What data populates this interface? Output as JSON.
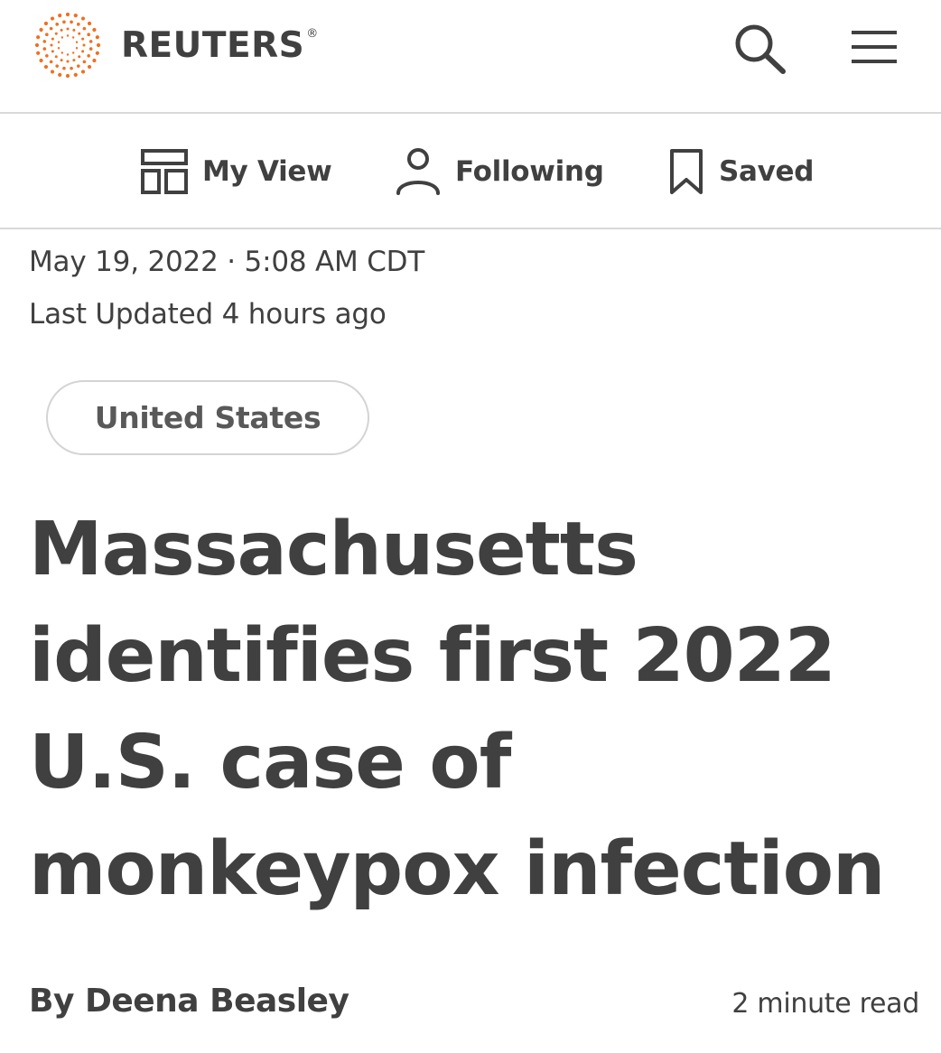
{
  "header": {
    "brand_name": "REUTERS",
    "brand_registered": "®",
    "brand_color": "#f26e1e",
    "search_icon": "search-icon",
    "menu_icon": "hamburger-menu-icon"
  },
  "subnav": {
    "items": [
      {
        "label": "My View",
        "icon": "layout-icon"
      },
      {
        "label": "Following",
        "icon": "person-icon"
      },
      {
        "label": "Saved",
        "icon": "bookmark-icon"
      }
    ]
  },
  "article": {
    "date": "May 19, 2022 · 5:08 AM CDT",
    "last_updated": "Last Updated 4 hours ago",
    "tag": "United States",
    "headline": "Massachusetts identifies first 2022 U.S. case of monkeypox infection",
    "byline_prefix": "By",
    "author": "Deena Beasley",
    "read_time": "2 minute read"
  },
  "colors": {
    "text": "#404040",
    "divider": "#d9d9d9",
    "accent": "#f26e1e"
  }
}
